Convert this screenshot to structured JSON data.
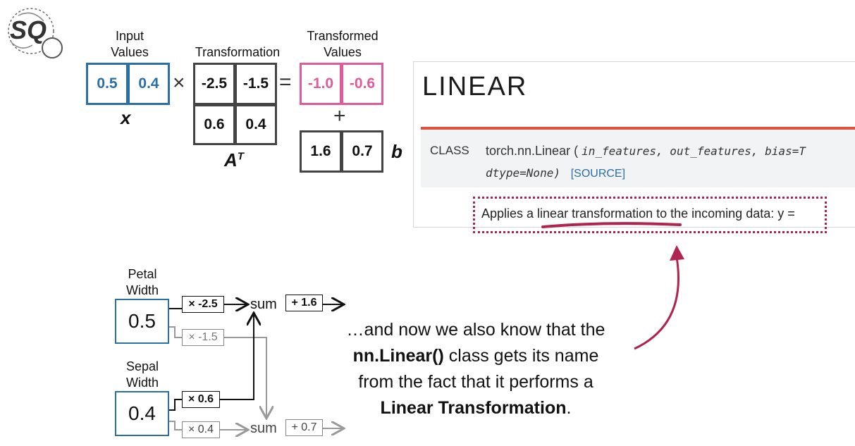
{
  "logo": {
    "text": "SQ"
  },
  "matrix_eq": {
    "input_label": "Input\nValues",
    "transform_label": "Transformation",
    "output_label": "Transformed\nValues",
    "x_vals": [
      "0.5",
      "0.4"
    ],
    "times": "×",
    "equals": "=",
    "plus": "+",
    "a_row1": [
      "-2.5",
      "-1.5"
    ],
    "a_row2": [
      "0.6",
      "0.4"
    ],
    "out_vals": [
      "-1.0",
      "-0.6"
    ],
    "b_vals": [
      "1.6",
      "0.7"
    ],
    "x_sym": "x",
    "a_sym": "A",
    "a_sup": "T",
    "b_sym": "b"
  },
  "doc": {
    "title": "LINEAR",
    "class_kw": "CLASS",
    "sig_name": "torch.nn.Linear",
    "sig_params": "in_features, out_features, bias=T",
    "sig_line2": "dtype=None)",
    "source": "[SOURCE]",
    "desc": "Applies a linear transformation to the incoming data: y ="
  },
  "network": {
    "petal_label": "Petal\nWidth",
    "sepal_label": "Sepal\nWidth",
    "petal_val": "0.5",
    "sepal_val": "0.4",
    "w1": "× -2.5",
    "w2": "× -1.5",
    "w3": "× 0.6",
    "w4": "× 0.4",
    "sum": "sum",
    "b1": "+ 1.6",
    "b2": "+ 0.7"
  },
  "narration": {
    "line1": "…and now we also know that the",
    "bold2": "nn.Linear()",
    "line2": " class gets its name",
    "line3": "from the fact that it performs a",
    "bold4": "Linear Transformation",
    "line4": "."
  },
  "colors": {
    "blue": "#2a6fa8",
    "pink": "#e05a9c",
    "red": "#e2513d",
    "maroon": "#a8254f"
  }
}
